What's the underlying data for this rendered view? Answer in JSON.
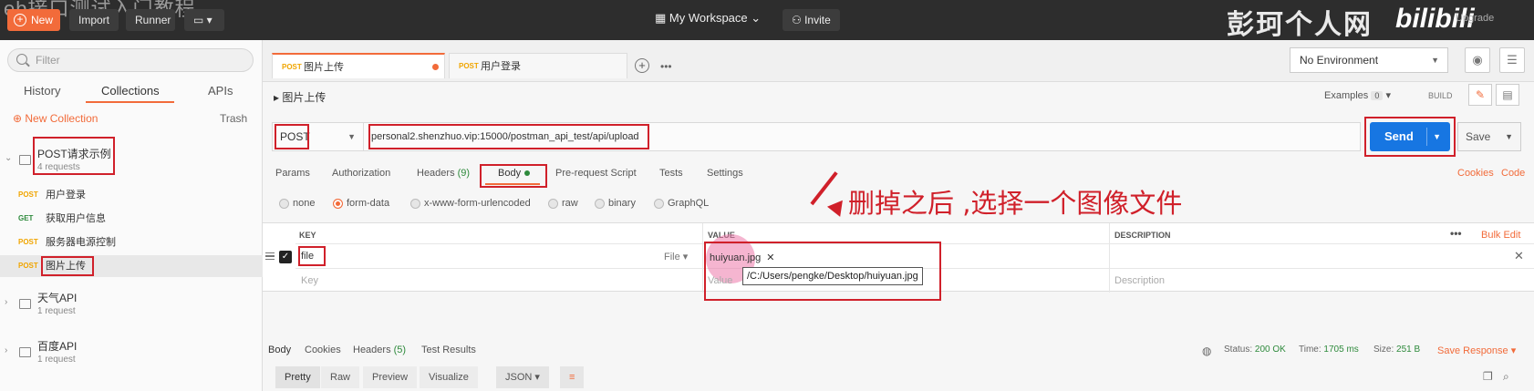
{
  "overlay": {
    "video_title": "eb接口测试入门教程",
    "watermark": "彭珂个人网",
    "bili": "bilibili"
  },
  "topbar": {
    "new_label": "New",
    "import_label": "Import",
    "runner_label": "Runner",
    "workspace_label": "My Workspace",
    "invite_label": "Invite",
    "upgrade_label": "Upgrade"
  },
  "sidebar": {
    "filter_placeholder": "Filter",
    "tabs": [
      "History",
      "Collections",
      "APIs"
    ],
    "new_collection": "New Collection",
    "trash": "Trash",
    "collections": [
      {
        "name": "POST请求示例",
        "count": "4 requests"
      },
      {
        "name": "天气API",
        "count": "1 request"
      },
      {
        "name": "百度API",
        "count": "1 request"
      }
    ],
    "requests": [
      {
        "method": "POST",
        "name": "用户登录"
      },
      {
        "method": "GET",
        "name": "获取用户信息"
      },
      {
        "method": "POST",
        "name": "服务器电源控制"
      },
      {
        "method": "POST",
        "name": "图片上传"
      }
    ]
  },
  "tabs": [
    {
      "method": "POST",
      "name": "图片上传"
    },
    {
      "method": "POST",
      "name": "用户登录"
    }
  ],
  "env": {
    "selected": "No Environment"
  },
  "request": {
    "title": "图片上传",
    "examples_label": "Examples",
    "examples_count": "0",
    "build_label": "BUILD",
    "method": "POST",
    "url": "personal2.shenzhuo.vip:15000/postman_api_test/api/upload",
    "send_label": "Send",
    "save_label": "Save"
  },
  "subtabs": {
    "params": "Params",
    "authorization": "Authorization",
    "headers": "Headers",
    "headers_count": "(9)",
    "body": "Body",
    "prerequest": "Pre-request Script",
    "tests": "Tests",
    "settings": "Settings",
    "cookies": "Cookies",
    "code": "Code"
  },
  "body_modes": [
    "none",
    "form-data",
    "x-www-form-urlencoded",
    "raw",
    "binary",
    "GraphQL"
  ],
  "table": {
    "headers": {
      "key": "KEY",
      "value": "VALUE",
      "description": "DESCRIPTION"
    },
    "bulk_edit": "Bulk Edit",
    "row": {
      "key": "file",
      "type": "File",
      "value": "huiyuan.jpg",
      "tooltip": "/C:/Users/pengke/Desktop/huiyuan.jpg"
    },
    "placeholder": {
      "key": "Key",
      "value": "Value",
      "description": "Description"
    }
  },
  "annotation": "删掉之后 ,选择一个图像文件",
  "response": {
    "tabs": [
      "Body",
      "Cookies",
      "Headers",
      "Test Results"
    ],
    "headers_count": "(5)",
    "status_label": "Status:",
    "status": "200 OK",
    "time_label": "Time:",
    "time": "1705 ms",
    "size_label": "Size:",
    "size": "251 B",
    "save_response": "Save Response",
    "views": [
      "Pretty",
      "Raw",
      "Preview",
      "Visualize"
    ],
    "format": "JSON"
  },
  "colors": {
    "accent": "#f26b3a",
    "send": "#1776e2",
    "annotation": "#d0202a",
    "get": "#2e8a3c",
    "post": "#f0a500"
  }
}
